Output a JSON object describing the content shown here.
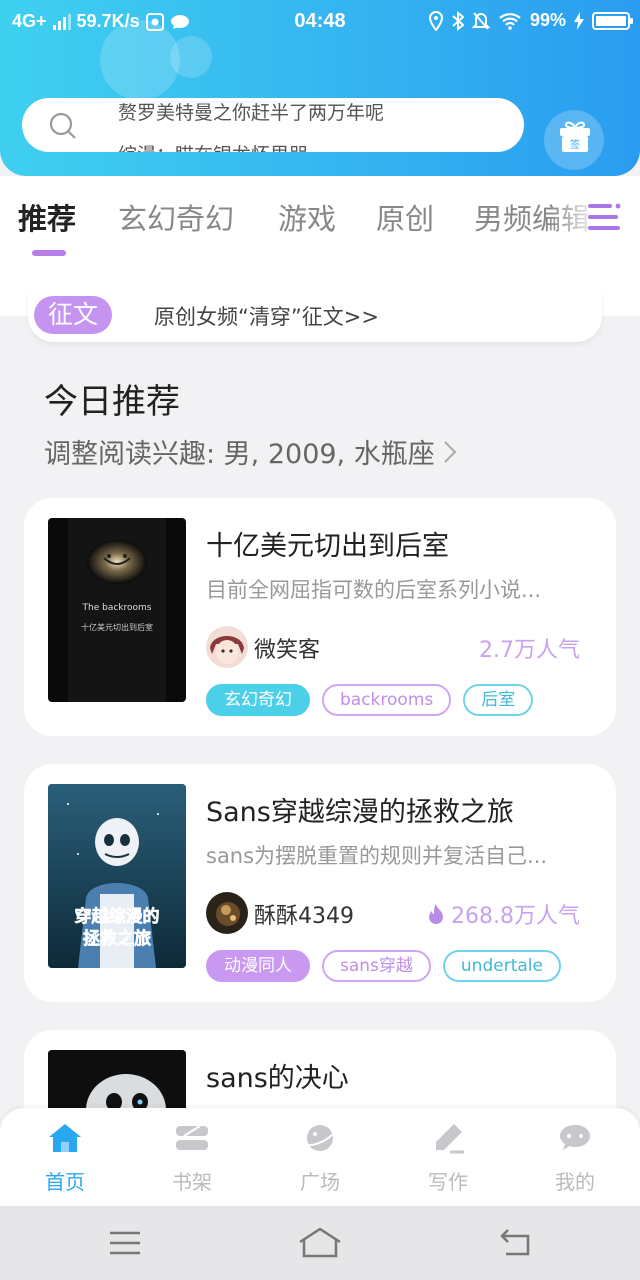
{
  "status_bar": {
    "network": "4G+",
    "speed": "59.7K/s",
    "time": "04:48",
    "battery": "99%",
    "battery_level": 0.99
  },
  "search": {
    "rotating_lines": [
      "赘罗美特曼之你赶半了两万年呢",
      "综漫：瞄在银龙怀里哭"
    ]
  },
  "gift": {
    "label": "签"
  },
  "tabs": [
    {
      "label": "推荐",
      "active": true
    },
    {
      "label": "玄幻奇幻"
    },
    {
      "label": "游戏"
    },
    {
      "label": "原创"
    },
    {
      "label": "男频编辑"
    }
  ],
  "notice": {
    "badge": "征文",
    "text": "原创女频“清穿”征文>>"
  },
  "section": {
    "title": "今日推荐",
    "subtitle": "调整阅读兴趣: 男, 2009, 水瓶座"
  },
  "books": [
    {
      "title": "十亿美元切出到后室",
      "desc": "目前全网屈指可数的后室系列小说...",
      "author": "微笑客",
      "popularity": "2.7万人气",
      "cover_text_1": "The backrooms",
      "cover_text_2": "十亿美元切出到后室",
      "tags": [
        "玄幻奇幻",
        "backrooms",
        "后室"
      ]
    },
    {
      "title": "Sans穿越综漫的拯救之旅",
      "desc": "sans为摆脱重置的规则并复活自己...",
      "author": "酥酥4349",
      "popularity": "268.8万人气",
      "cover_text_1": "穿越综漫的",
      "cover_text_2": "拯救之旅",
      "tags": [
        "动漫同人",
        "sans穿越",
        "undertale"
      ]
    },
    {
      "title": "sans的决心"
    }
  ],
  "bottom_nav": [
    {
      "label": "首页",
      "icon": "home-icon",
      "active": true
    },
    {
      "label": "书架",
      "icon": "bookshelf-icon"
    },
    {
      "label": "广场",
      "icon": "planet-icon"
    },
    {
      "label": "写作",
      "icon": "pen-icon"
    },
    {
      "label": "我的",
      "icon": "chat-bubble-icon"
    }
  ],
  "colors": {
    "header_start": "#3fd0f0",
    "header_end": "#2a9cf0",
    "accent_purple": "#b67ee8",
    "accent_blue": "#2aa8ef"
  }
}
